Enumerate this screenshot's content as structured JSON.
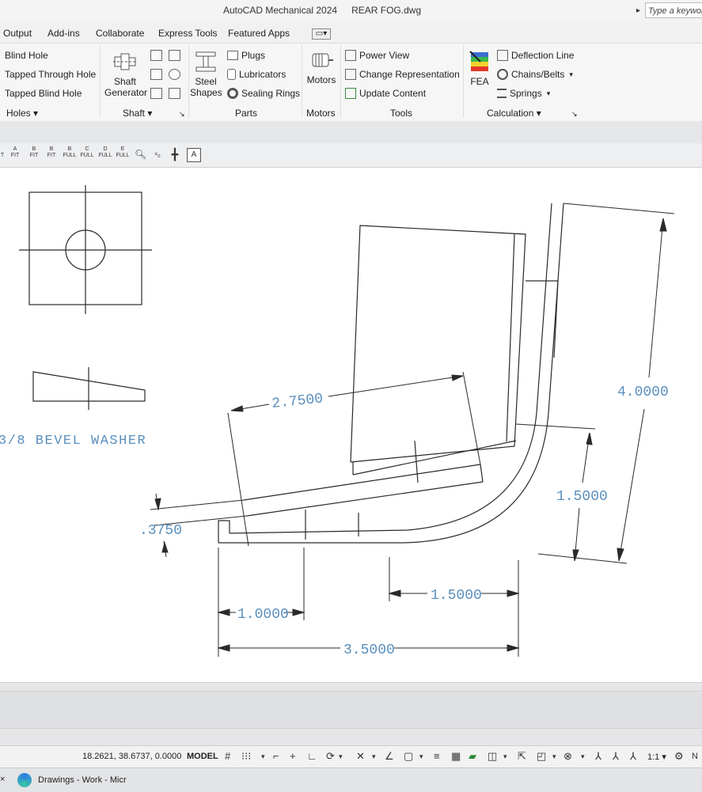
{
  "window": {
    "app_title": "AutoCAD Mechanical 2024",
    "document_title": "REAR FOG.dwg",
    "search_placeholder": "Type a keywor"
  },
  "tabs": [
    {
      "label": "Output"
    },
    {
      "label": "Add-ins"
    },
    {
      "label": "Collaborate"
    },
    {
      "label": "Express Tools"
    },
    {
      "label": "Featured Apps"
    }
  ],
  "ribbon": {
    "holes": {
      "items": [
        "Blind Hole",
        "Tapped Through Hole",
        "Tapped Blind Hole"
      ],
      "panel_title": "Holes"
    },
    "shaft": {
      "generator_label_1": "Shaft",
      "generator_label_2": "Generator",
      "panel_title": "Shaft"
    },
    "parts": {
      "steel_label_1": "Steel",
      "steel_label_2": "Shapes",
      "items": [
        "Plugs",
        "Lubricators",
        "Sealing Rings"
      ],
      "panel_title": "Parts"
    },
    "motors": {
      "button_label": "Motors",
      "panel_title": "Motors"
    },
    "tools": {
      "items": [
        "Power View",
        "Change Representation",
        "Update Content"
      ],
      "panel_title": "Tools"
    },
    "calculation": {
      "fea_label": "FEA",
      "items": [
        "Deflection Line",
        "Chains/Belts",
        "Springs"
      ],
      "panel_title": "Calculation"
    }
  },
  "view_toolbar": {
    "buttons": [
      {
        "top": "A",
        "bottom": "FIT"
      },
      {
        "top": "B",
        "bottom": "FIT"
      },
      {
        "top": "B",
        "bottom": "FIT"
      },
      {
        "top": "B",
        "bottom": "FULL"
      },
      {
        "top": "C",
        "bottom": "FULL"
      },
      {
        "top": "D",
        "bottom": "FULL"
      },
      {
        "top": "E",
        "bottom": "FULL"
      }
    ]
  },
  "drawing": {
    "washer_label": "3/8 BEVEL WASHER",
    "dimensions": {
      "length_top": "2.7500",
      "thickness": ".3750",
      "height_total": "4.0000",
      "height_lower": "1.5000",
      "base_left": "1.0000",
      "base_right": "1.5000",
      "base_total": "3.5000"
    },
    "line_color": "#2a2a2a",
    "dim_text_color": "#5a8fbd"
  },
  "status_bar": {
    "coordinates": "18.2621, 38.6737, 0.0000",
    "model_label": "MODEL",
    "annotation_scale": "1:1"
  },
  "taskbar": {
    "item_label": "Drawings - Work - Micr"
  }
}
